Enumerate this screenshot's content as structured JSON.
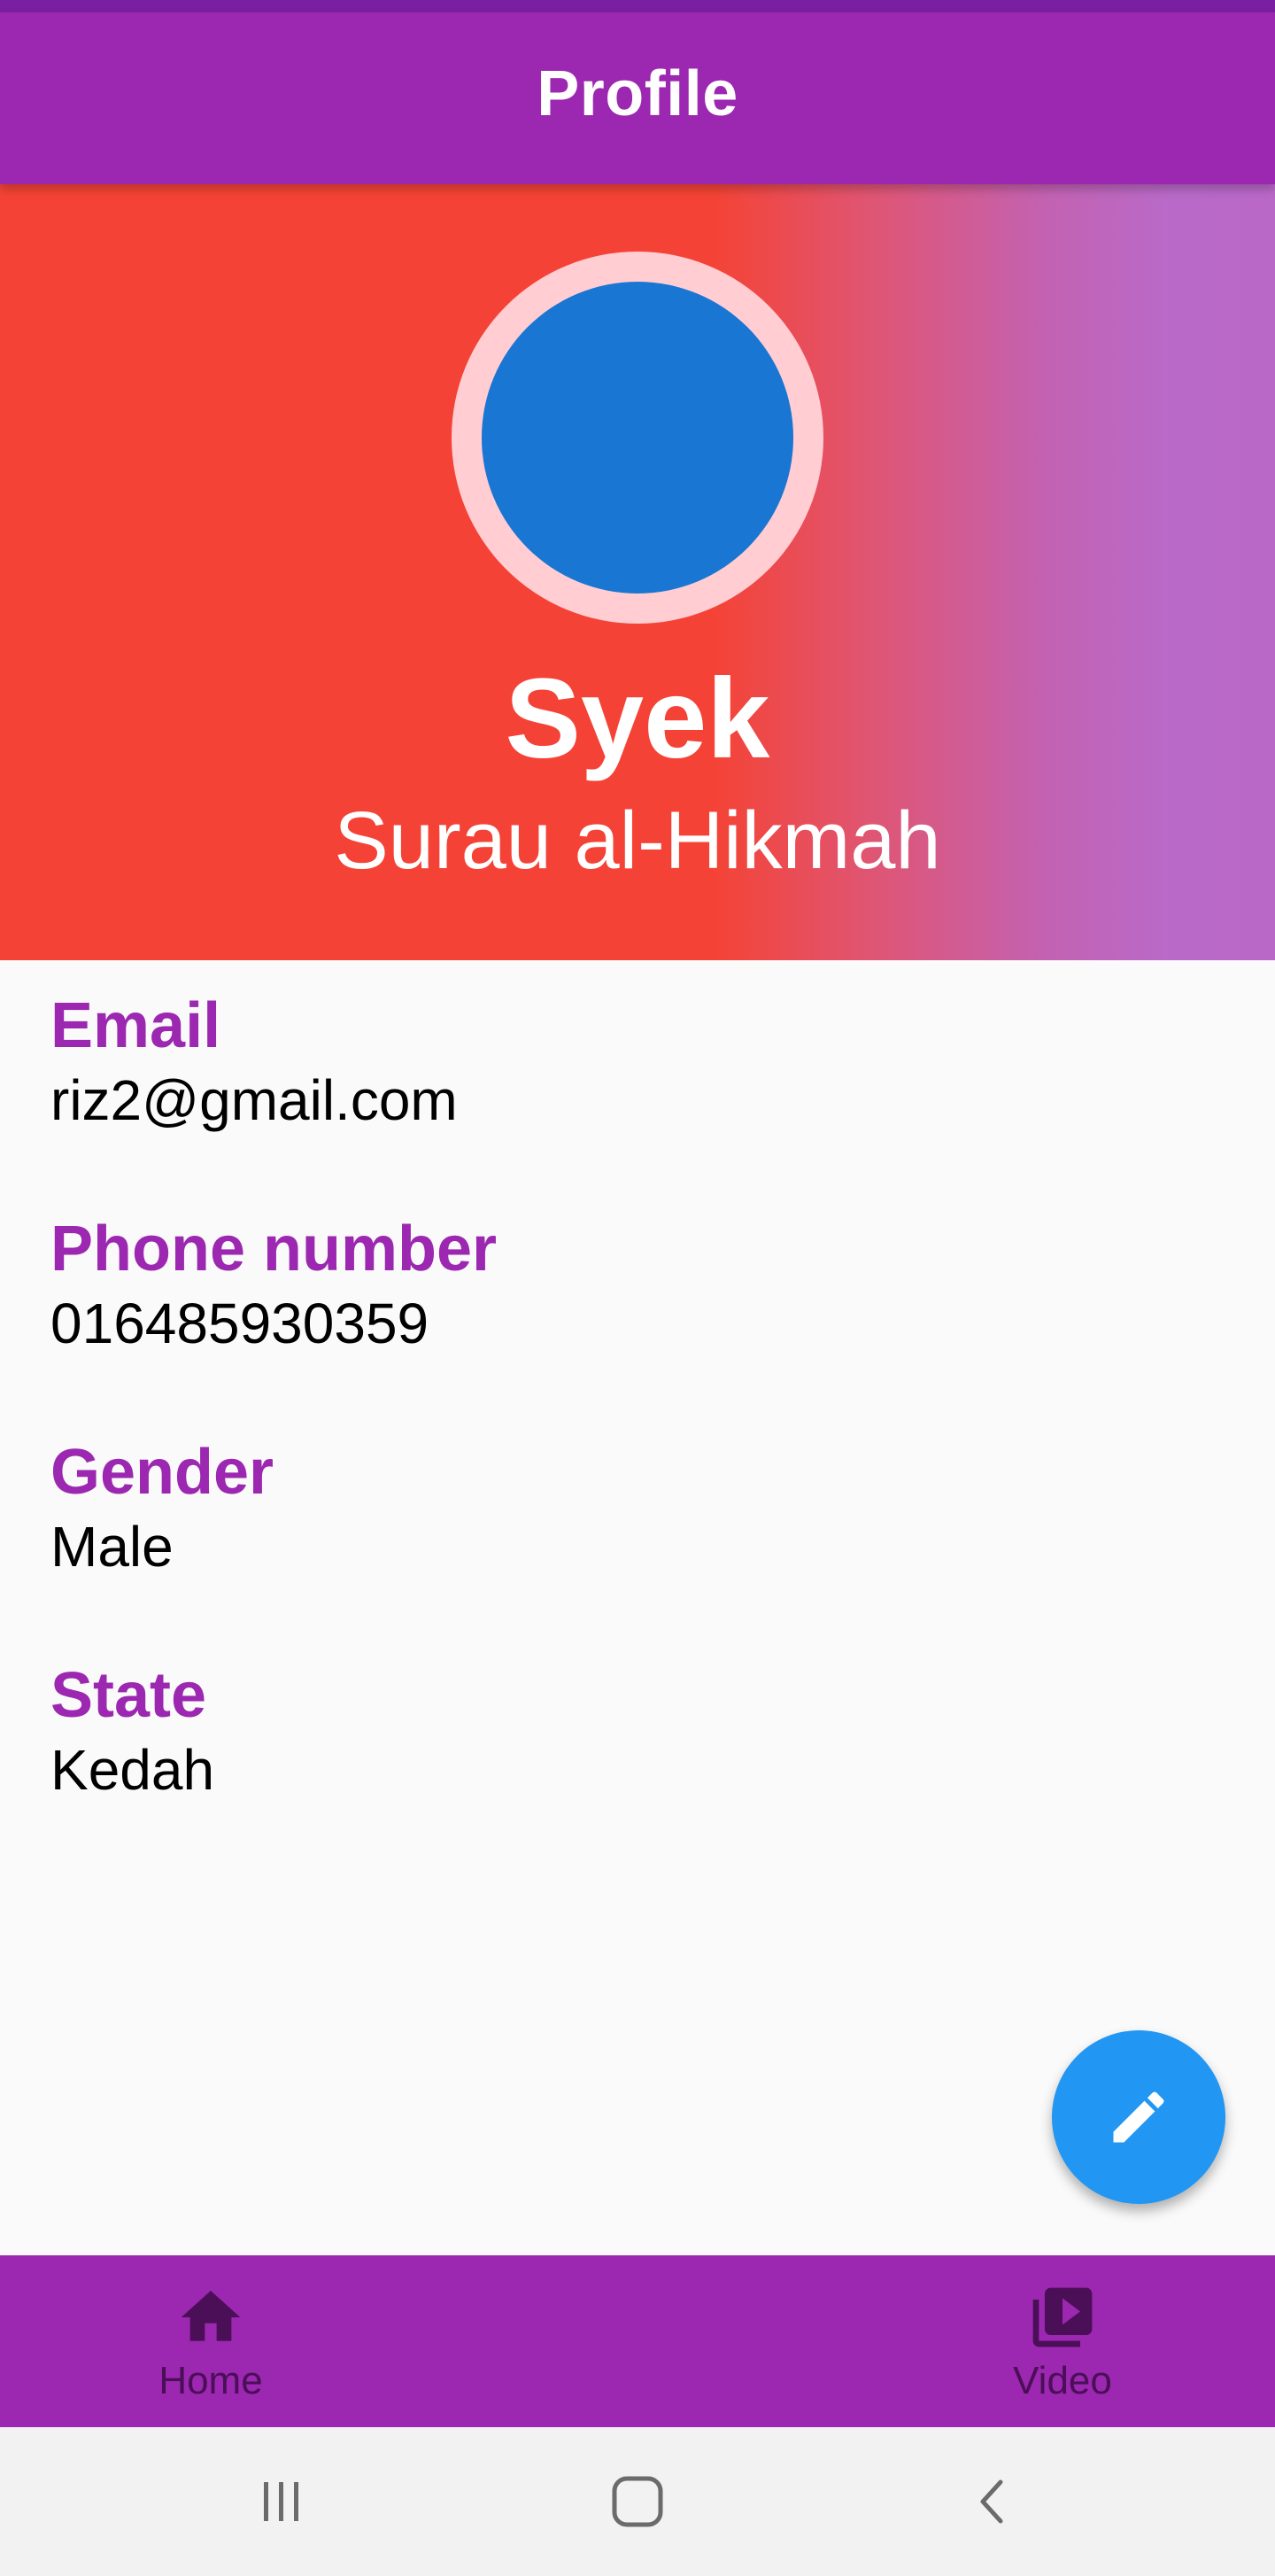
{
  "app_bar": {
    "title": "Profile"
  },
  "header": {
    "name": "Syek",
    "organization": "Surau al-Hikmah"
  },
  "details": [
    {
      "label": "Email",
      "value": "riz2@gmail.com"
    },
    {
      "label": "Phone number",
      "value": "016485930359"
    },
    {
      "label": "Gender",
      "value": "Male"
    },
    {
      "label": "State",
      "value": "Kedah"
    }
  ],
  "fab": {
    "icon": "edit-icon"
  },
  "bottom_nav": {
    "items": [
      {
        "label": "Home",
        "icon": "home-icon"
      },
      {
        "label": "Video",
        "icon": "video-library-icon"
      }
    ]
  },
  "system_nav": {
    "icons": [
      "recent-apps-icon",
      "home-button-icon",
      "back-icon"
    ]
  },
  "colors": {
    "primary": "#9c27b0",
    "status_bar": "#7b1fa2",
    "header_start": "#f44336",
    "header_end": "#ba68c8",
    "avatar": "#1976d2",
    "avatar_ring": "#ffcdd2",
    "fab": "#2196f3",
    "label": "#9c27b0"
  }
}
